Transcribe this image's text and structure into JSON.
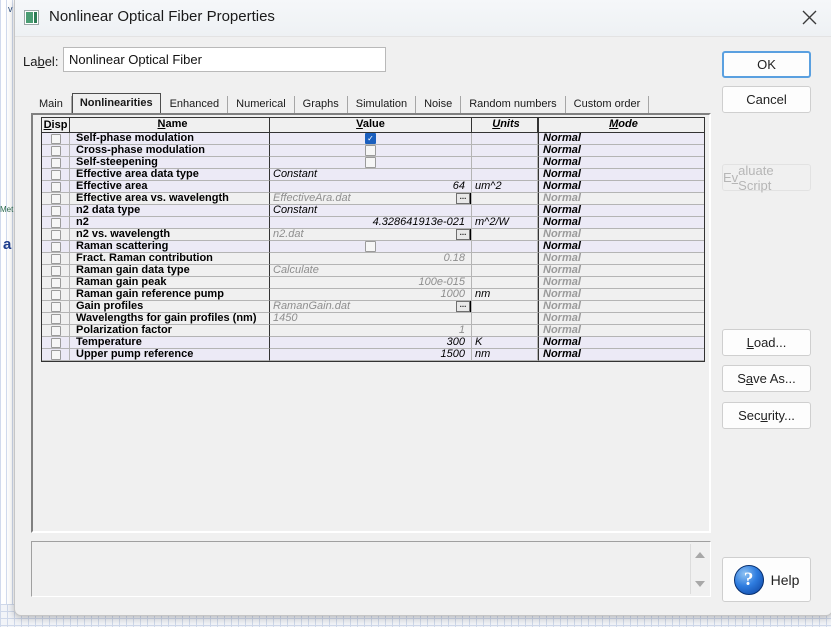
{
  "backdrop": {
    "text1": "v",
    "text2": "Met",
    "text3": "a"
  },
  "window": {
    "title": "Nonlinear Optical Fiber Properties",
    "icon": "app-icon",
    "close_icon": "close-icon"
  },
  "label": {
    "caption_pre": "La",
    "caption_accel": "b",
    "caption_post": "el:",
    "value": "Nonlinear Optical Fiber",
    "placeholder": ""
  },
  "tabs": [
    {
      "label": "Main",
      "active": false
    },
    {
      "label": "Nonlinearities",
      "active": true
    },
    {
      "label": "Enhanced",
      "active": false
    },
    {
      "label": "Numerical",
      "active": false
    },
    {
      "label": "Graphs",
      "active": false
    },
    {
      "label": "Simulation",
      "active": false
    },
    {
      "label": "Noise",
      "active": false
    },
    {
      "label": "Random numbers",
      "active": false
    },
    {
      "label": "Custom order",
      "active": false
    }
  ],
  "grid": {
    "headers": [
      {
        "label": "Disp",
        "accel": "D"
      },
      {
        "label": "Name",
        "accel": "N"
      },
      {
        "label": "Value",
        "accel": "V"
      },
      {
        "label": "Units",
        "accel": "U"
      },
      {
        "label": "Mode",
        "accel": "M"
      }
    ],
    "rows": [
      {
        "disp": false,
        "name": "Self-phase modulation",
        "value_type": "checkbox",
        "value": true,
        "units": "",
        "mode": "Normal",
        "mode_gray": false,
        "shade": "alt"
      },
      {
        "disp": false,
        "name": "Cross-phase modulation",
        "value_type": "checkbox",
        "value": false,
        "units": "",
        "mode": "Normal",
        "mode_gray": false,
        "shade": "alt"
      },
      {
        "disp": false,
        "name": "Self-steepening",
        "value_type": "checkbox",
        "value": false,
        "units": "",
        "mode": "Normal",
        "mode_gray": false,
        "shade": "alt"
      },
      {
        "disp": false,
        "name": "Effective area data type",
        "value_type": "text",
        "value": "Constant",
        "units": "",
        "mode": "Normal",
        "mode_gray": false,
        "shade": "alt"
      },
      {
        "disp": false,
        "name": "Effective area",
        "value_type": "number",
        "value": "64",
        "units": "um^2",
        "mode": "Normal",
        "mode_gray": false,
        "shade": "alt"
      },
      {
        "disp": false,
        "name": "Effective area vs. wavelength",
        "value_type": "file",
        "value": "EffectiveAra.dat",
        "units": "",
        "mode": "Normal",
        "mode_gray": true,
        "shade": "plain"
      },
      {
        "disp": false,
        "name": "n2 data type",
        "value_type": "text",
        "value": "Constant",
        "units": "",
        "mode": "Normal",
        "mode_gray": false,
        "shade": "alt"
      },
      {
        "disp": false,
        "name": "n2",
        "value_type": "number",
        "value": "4.328641913e-021",
        "units": "m^2/W",
        "mode": "Normal",
        "mode_gray": false,
        "shade": "alt"
      },
      {
        "disp": false,
        "name": "n2 vs. wavelength",
        "value_type": "file",
        "value": "n2.dat",
        "units": "",
        "mode": "Normal",
        "mode_gray": true,
        "shade": "plain"
      },
      {
        "disp": false,
        "name": "Raman scattering",
        "value_type": "checkbox",
        "value": false,
        "units": "",
        "mode": "Normal",
        "mode_gray": false,
        "shade": "alt"
      },
      {
        "disp": false,
        "name": "Fract. Raman contribution",
        "value_type": "number_gray",
        "value": "0.18",
        "units": "",
        "mode": "Normal",
        "mode_gray": true,
        "shade": "plain"
      },
      {
        "disp": false,
        "name": "Raman gain data type",
        "value_type": "text_gray",
        "value": "Calculate",
        "units": "",
        "mode": "Normal",
        "mode_gray": true,
        "shade": "plain"
      },
      {
        "disp": false,
        "name": "Raman gain peak",
        "value_type": "number_gray",
        "value": "100e-015",
        "units": "",
        "mode": "Normal",
        "mode_gray": true,
        "shade": "plain"
      },
      {
        "disp": false,
        "name": "Raman gain reference pump",
        "value_type": "number_gray",
        "value": "1000",
        "units": "nm",
        "mode": "Normal",
        "mode_gray": true,
        "shade": "plain"
      },
      {
        "disp": false,
        "name": "Gain profiles",
        "value_type": "file",
        "value": "RamanGain.dat",
        "units": "",
        "mode": "Normal",
        "mode_gray": true,
        "shade": "plain"
      },
      {
        "disp": false,
        "name": "Wavelengths for gain profiles (nm)",
        "value_type": "text_gray",
        "value": "1450",
        "units": "",
        "mode": "Normal",
        "mode_gray": true,
        "shade": "plain"
      },
      {
        "disp": false,
        "name": "Polarization factor",
        "value_type": "number_gray",
        "value": "1",
        "units": "",
        "mode": "Normal",
        "mode_gray": true,
        "shade": "plain"
      },
      {
        "disp": false,
        "name": "Temperature",
        "value_type": "number",
        "value": "300",
        "units": "K",
        "mode": "Normal",
        "mode_gray": false,
        "shade": "alt"
      },
      {
        "disp": false,
        "name": "Upper pump reference",
        "value_type": "number",
        "value": "1500",
        "units": "nm",
        "mode": "Normal",
        "mode_gray": false,
        "shade": "alt"
      }
    ],
    "dots_label": "..."
  },
  "scrollbar": {
    "up_icon": "scroll-up-arrow-icon",
    "down_icon": "scroll-down-arrow-icon"
  },
  "buttons": {
    "ok": "OK",
    "cancel": "Cancel",
    "evaluate_script_pre": "E",
    "evaluate_script_accel": "v",
    "evaluate_script_post": "aluate Script",
    "load_accel": "L",
    "load_post": "oad...",
    "saveas_pre": "S",
    "saveas_accel": "a",
    "saveas_post": "ve As...",
    "security_pre": "Sec",
    "security_accel": "u",
    "security_post": "rity...",
    "help": "Help",
    "help_icon": "help-question-icon"
  },
  "colors": {
    "accent": "#5aa0e0",
    "checkbox_checked": "#1b5fbe",
    "row_alt": "#eceaf6",
    "row_plain": "#f0f0f0",
    "dialog_bg": "#f0f0f0"
  }
}
